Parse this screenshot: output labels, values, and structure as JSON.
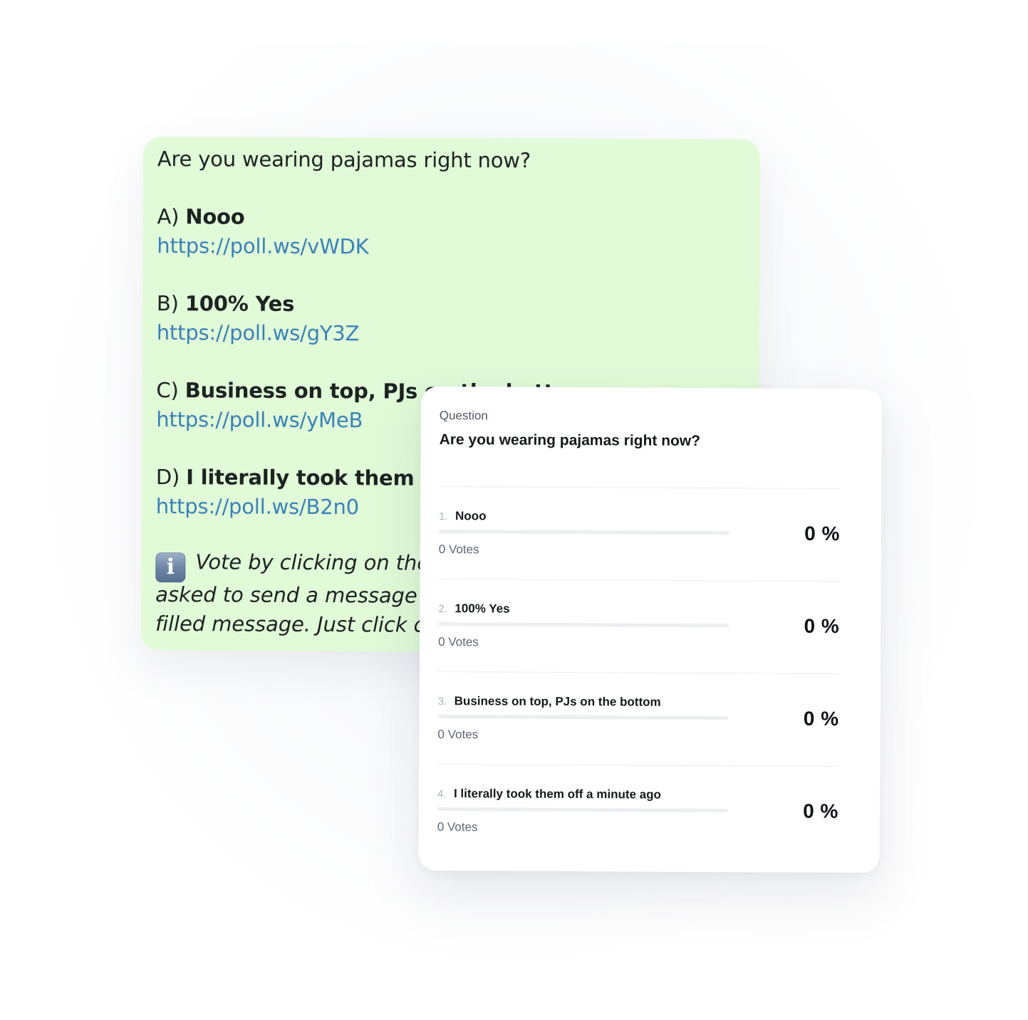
{
  "chat_message": {
    "question": "Are you wearing pajamas right now?",
    "options": [
      {
        "letter": "A)",
        "text": "Nooo",
        "link": "https://poll.ws/vWDK"
      },
      {
        "letter": "B)",
        "text": "100% Yes",
        "link": "https://poll.ws/gY3Z"
      },
      {
        "letter": "C)",
        "text": "Business on top, PJs on the bottom",
        "link": "https://poll.ws/yMeB"
      },
      {
        "letter": "D)",
        "text": "I literally took them off a minute ago",
        "link": "https://poll.ws/B2n0"
      }
    ],
    "info_icon": "information-icon",
    "info_lines": [
      "Vote by clicking on the",
      "asked to send a message t",
      "filled message. Just click c"
    ]
  },
  "poll_card": {
    "question_label": "Question",
    "question": "Are you wearing pajamas right now?",
    "options": [
      {
        "number": "1.",
        "label": "Nooo",
        "votes": "0 Votes",
        "percent": "0 %",
        "share": 0
      },
      {
        "number": "2.",
        "label": "100% Yes",
        "votes": "0 Votes",
        "percent": "0 %",
        "share": 0
      },
      {
        "number": "3.",
        "label": "Business on top, PJs on the bottom",
        "votes": "0 Votes",
        "percent": "0 %",
        "share": 0
      },
      {
        "number": "4.",
        "label": "I literally took them off a minute ago",
        "votes": "0 Votes",
        "percent": "0 %",
        "share": 0
      }
    ]
  },
  "colors": {
    "bubble_background": "#e1fad8",
    "link": "#3a82b8",
    "card_background": "#ffffff"
  }
}
